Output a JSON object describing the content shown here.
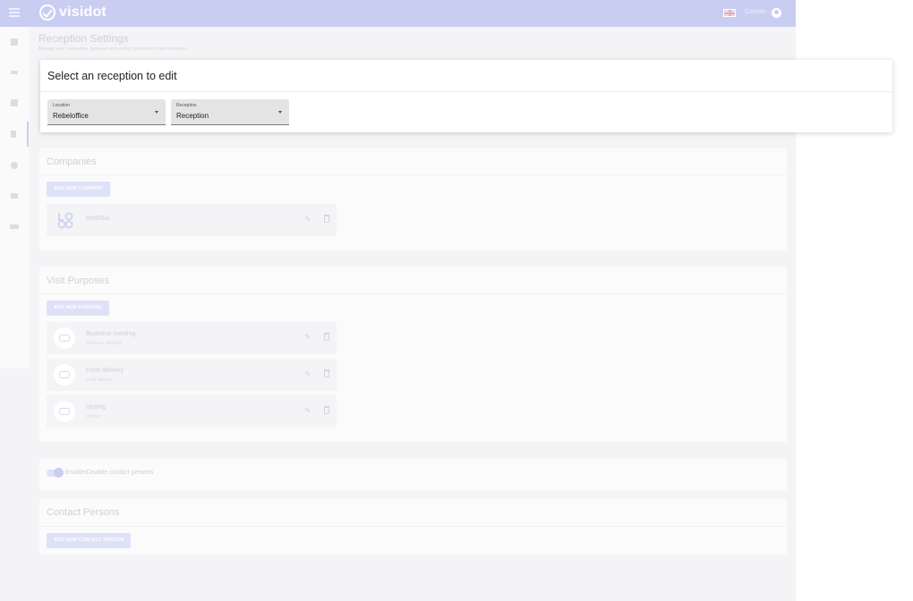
{
  "topbar": {
    "brand": "visidot",
    "user_name": "Cosmin",
    "language_flag": "uk-flag-icon"
  },
  "sidebar": {
    "items": [
      "dashboard-icon",
      "filter-icon",
      "locations-icon",
      "reception-icon",
      "purposes-icon",
      "billing-icon",
      "users-icon"
    ],
    "active_index": 3
  },
  "page": {
    "title": "Reception Settings",
    "subtitle": "Manage your companies, purposes and contact persons for each reception"
  },
  "dialog": {
    "title": "Select an reception to edit",
    "location": {
      "label": "Location",
      "value": "Rebeloffice"
    },
    "reception": {
      "label": "Reception",
      "value": "Reception"
    }
  },
  "companies": {
    "title": "Companies",
    "add_label": "ADD NEW COMPANY",
    "items": [
      {
        "name": "RedSluu"
      }
    ]
  },
  "purposes": {
    "title": "Visit Purposes",
    "add_label": "ADD NEW PURPOSE",
    "items": [
      {
        "name": "Business meeting",
        "sub": "Business meeting"
      },
      {
        "name": "Food delivery",
        "sub": "Food delivery"
      },
      {
        "name": "Visiting",
        "sub": "Visiting"
      }
    ]
  },
  "contact_toggle": {
    "label": "Enable/Disable contact persons",
    "enabled": true
  },
  "contacts": {
    "title": "Contact Persons",
    "add_label": "ADD NEW CONTACT PERSON"
  },
  "colors": {
    "accent": "#c9cdf2",
    "topbar": "#c9cdf2",
    "background": "#f4f4f6"
  }
}
